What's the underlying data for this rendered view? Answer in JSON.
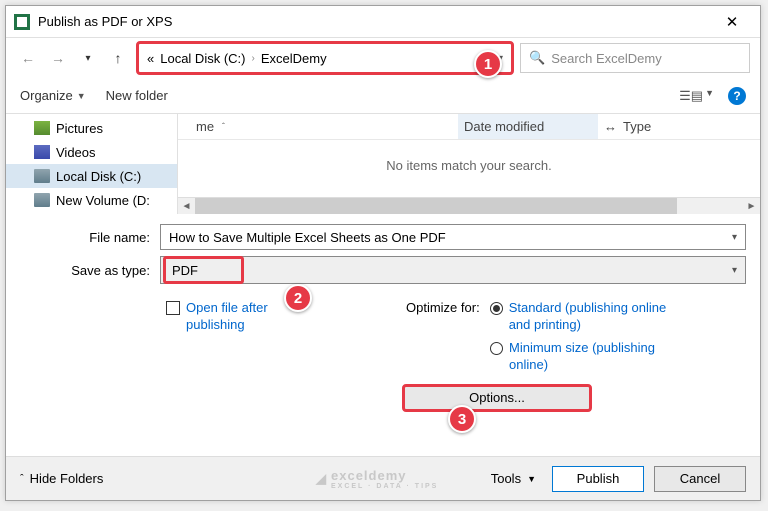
{
  "title": "Publish as PDF or XPS",
  "breadcrumb": {
    "root": "Local Disk (C:)",
    "folder": "ExcelDemy",
    "prefix": "«"
  },
  "search": {
    "placeholder": "Search ExcelDemy"
  },
  "toolbar": {
    "organize": "Organize",
    "newfolder": "New folder"
  },
  "tree": {
    "pictures": "Pictures",
    "videos": "Videos",
    "localc": "Local Disk (C:)",
    "newvol": "New Volume (D:"
  },
  "list": {
    "h_name": "me",
    "h_date": "Date modified",
    "h_type": "Type",
    "empty": "No items match your search."
  },
  "form": {
    "filename_label": "File name:",
    "filename_value": "How to Save Multiple Excel Sheets as One PDF",
    "saveas_label": "Save as type:",
    "saveas_value": "PDF",
    "openafter": "Open file after publishing",
    "optimize_label": "Optimize for:",
    "opt_standard": "Standard (publishing online and printing)",
    "opt_min": "Minimum size (publishing online)",
    "options": "Options..."
  },
  "bottom": {
    "hidefolders": "Hide Folders",
    "tools": "Tools",
    "publish": "Publish",
    "cancel": "Cancel"
  },
  "badges": {
    "b1": "1",
    "b2": "2",
    "b3": "3"
  },
  "watermark": {
    "main": "exceldemy",
    "sub": "EXCEL · DATA · TIPS"
  }
}
